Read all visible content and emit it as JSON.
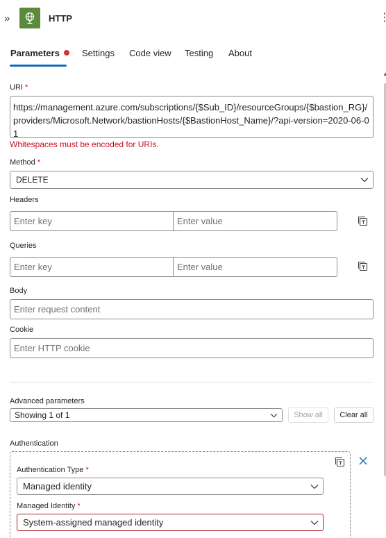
{
  "header": {
    "title": "HTTP",
    "app_icon": "http-globe-icon",
    "accent_color": "#5a8a3a"
  },
  "tabs": [
    {
      "label": "Parameters",
      "active": true,
      "has_error": true
    },
    {
      "label": "Settings"
    },
    {
      "label": "Code view"
    },
    {
      "label": "Testing"
    },
    {
      "label": "About"
    }
  ],
  "uri": {
    "label": "URI",
    "required_mark": "*",
    "value": "https://management.azure.com/subscriptions/{$Sub_ID}/resourceGroups/{$bastion_RG}/providers/Microsoft.Network/bastionHosts/{$BastionHost_Name}/?api-version=2020-06-01",
    "error": "Whitespaces must be encoded for URIs."
  },
  "method": {
    "label": "Method",
    "required_mark": "*",
    "value": "DELETE"
  },
  "headers": {
    "label": "Headers",
    "key_placeholder": "Enter key",
    "value_placeholder": "Enter value"
  },
  "queries": {
    "label": "Queries",
    "key_placeholder": "Enter key",
    "value_placeholder": "Enter value"
  },
  "body": {
    "label": "Body",
    "placeholder": "Enter request content"
  },
  "cookie": {
    "label": "Cookie",
    "placeholder": "Enter HTTP cookie"
  },
  "advanced": {
    "label": "Advanced parameters",
    "value": "Showing 1 of 1",
    "show_all": "Show all",
    "clear_all": "Clear all"
  },
  "auth": {
    "label": "Authentication",
    "type_label": "Authentication Type",
    "type_value": "Managed identity",
    "identity_label": "Managed Identity",
    "identity_value": "System-assigned managed identity",
    "required_mark": "*"
  },
  "colors": {
    "accent": "#0f6cbd",
    "error": "#c50f1f"
  }
}
